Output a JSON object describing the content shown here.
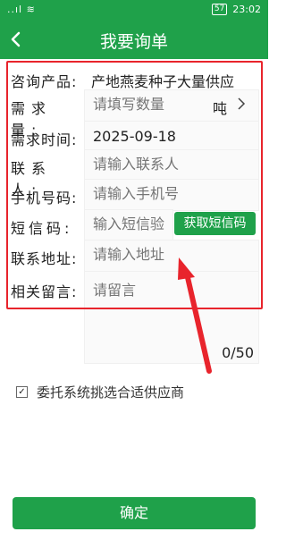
{
  "status_bar": {
    "signal": "..ıl ≋",
    "battery": "57",
    "time": "23:02"
  },
  "header": {
    "title": "我要询单"
  },
  "form": {
    "product": {
      "label": "咨询产品:",
      "value": "产地燕麦种子大量供应"
    },
    "quantity": {
      "label": "需求量:",
      "placeholder": "请填写数量",
      "unit": "吨"
    },
    "time": {
      "label": "需求时间:",
      "value": "2025-09-18"
    },
    "contact": {
      "label": "联系人:",
      "placeholder": "请输入联系人"
    },
    "phone": {
      "label": "手机号码:",
      "placeholder": "请输入手机号"
    },
    "sms": {
      "label": "短信码:",
      "placeholder": "输入短信验",
      "button": "获取短信码"
    },
    "address": {
      "label": "联系地址:",
      "placeholder": "请输入地址"
    },
    "message": {
      "label": "相关留言:",
      "placeholder": "请留言",
      "counter": "0/50"
    }
  },
  "option": {
    "label": "委托系统挑选合适供应商",
    "checked": true
  },
  "confirm_label": "确定",
  "colors": {
    "primary": "#1fa14a",
    "annotation": "#e8242c"
  },
  "icons": [
    "back-arrow-icon",
    "chevron-right-icon",
    "checkbox-icon",
    "annotation-arrow-icon"
  ]
}
